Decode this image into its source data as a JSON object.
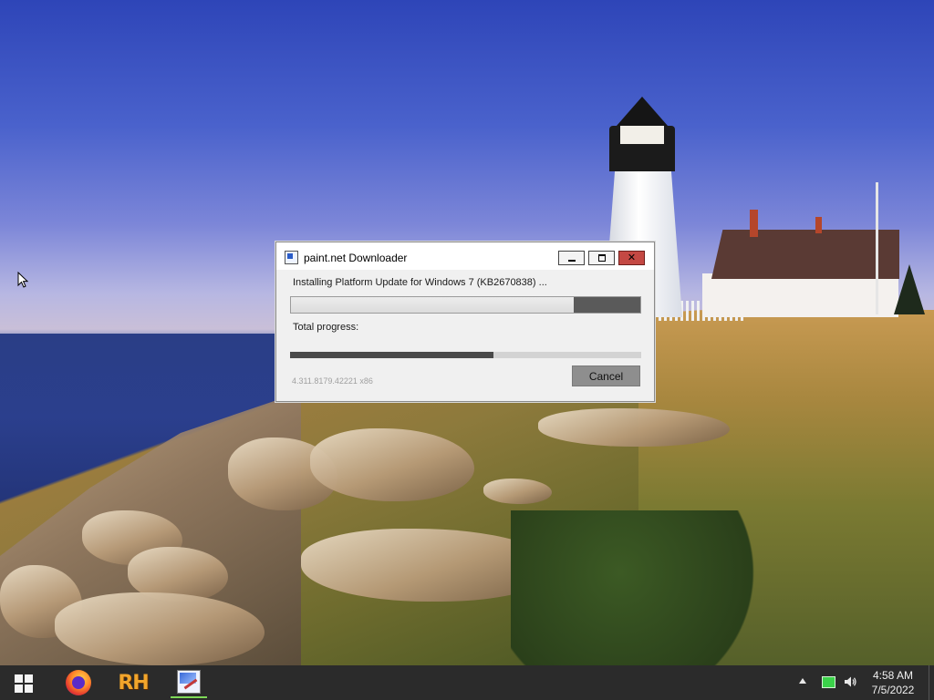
{
  "wallpaper": {
    "name": "lighthouse-wallpaper"
  },
  "dialog": {
    "title": "paint.net Downloader",
    "status": "Installing Platform Update for Windows 7 (KB2670838) ...",
    "current_progress": 0.81,
    "total_label": "Total progress:",
    "total_progress": 0.58,
    "version": "4.311.8179.42221 x86",
    "cancel_label": "Cancel",
    "icons": {
      "app": "paintnet-downloader-icon",
      "minimize": "minimize-icon",
      "maximize": "maximize-icon",
      "close": "close-icon"
    },
    "close_glyph": "✕"
  },
  "taskbar": {
    "start_icon": "windows-logo-icon",
    "apps": [
      {
        "name": "firefox-icon"
      },
      {
        "name": "rh-icon",
        "label": "RH"
      },
      {
        "name": "paintnet-icon",
        "active": true
      }
    ],
    "tray": {
      "overflow_icon": "chevron-up-icon",
      "network_icon": "network-icon",
      "volume_icon": "volume-icon"
    },
    "clock": {
      "time": "4:58 AM",
      "date": "7/5/2022"
    }
  },
  "colors": {
    "close_button": "#c44843",
    "taskbar": "#2b2b2b",
    "active_indicator": "#7ed957",
    "network_icon": "#3bd24a"
  }
}
